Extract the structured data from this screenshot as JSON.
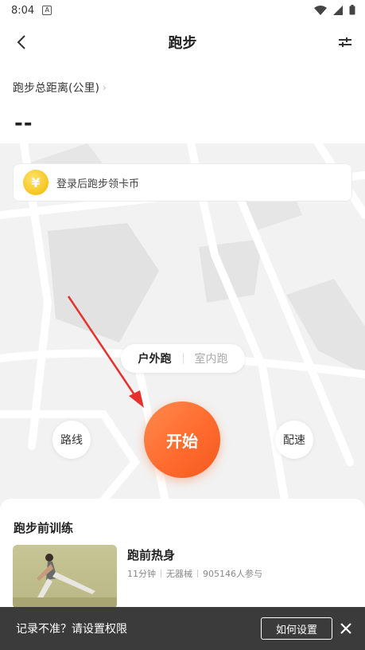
{
  "status_bar": {
    "time": "8:04",
    "notif_icon": "A"
  },
  "header": {
    "title": "跑步"
  },
  "distance": {
    "label": "跑步总距离(公里)",
    "value": "--"
  },
  "coin_banner": {
    "text": "登录后跑步领卡币"
  },
  "mode_toggle": {
    "outdoor": "户外跑",
    "indoor": "室内跑"
  },
  "buttons": {
    "route": "路线",
    "start": "开始",
    "pace": "配速"
  },
  "training": {
    "section_title": "跑步前训练",
    "course": {
      "title": "跑前热身",
      "duration": "11分钟",
      "equipment": "无器械",
      "participants": "905146人参与"
    }
  },
  "toast": {
    "text": "记录不准？请设置权限",
    "action": "如何设置"
  },
  "colors": {
    "accent": "#ff6b2e",
    "arrow": "#e5322d"
  }
}
